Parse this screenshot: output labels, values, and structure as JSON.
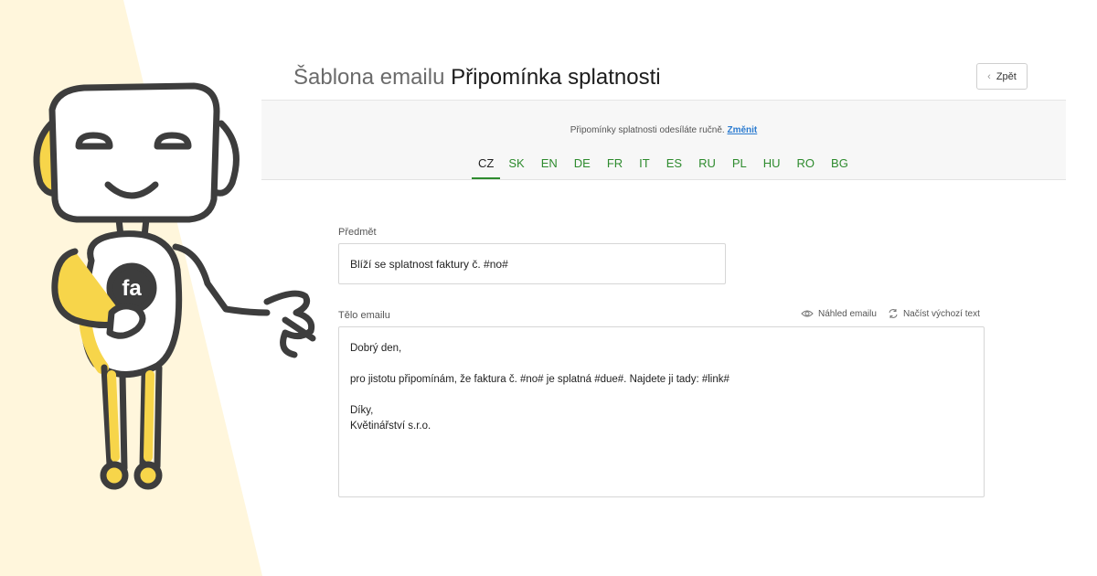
{
  "header": {
    "title_prefix": "Šablona emailu",
    "title_main": "Připomínka splatnosti",
    "back_label": "Zpět"
  },
  "notice": {
    "text": "Připomínky splatnosti odesíláte ručně.",
    "link_label": "Změnit"
  },
  "languages": [
    "CZ",
    "SK",
    "EN",
    "DE",
    "FR",
    "IT",
    "ES",
    "RU",
    "PL",
    "HU",
    "RO",
    "BG"
  ],
  "active_language": "CZ",
  "subject": {
    "label": "Předmět",
    "value": "Blíží se splatnost faktury č. #no#"
  },
  "body": {
    "label": "Tělo emailu",
    "preview_label": "Náhled emailu",
    "reset_label": "Načíst výchozí text",
    "lines": [
      "Dobrý den,",
      "",
      "pro jistotu připomínám, že faktura č. #no# je splatná #due#. Najdete ji tady: #link#",
      "",
      "Díky,",
      "Květinářství s.r.o."
    ]
  },
  "colors": {
    "accent_green": "#2e8b2e",
    "link_blue": "#2b7bd0",
    "robot_yellow": "#f7d54a",
    "background_cream": "#fff6dc"
  },
  "icons": {
    "back": "chevron-left-icon",
    "preview": "eye-icon",
    "reset": "refresh-icon",
    "mascot": "robot-mascot"
  }
}
